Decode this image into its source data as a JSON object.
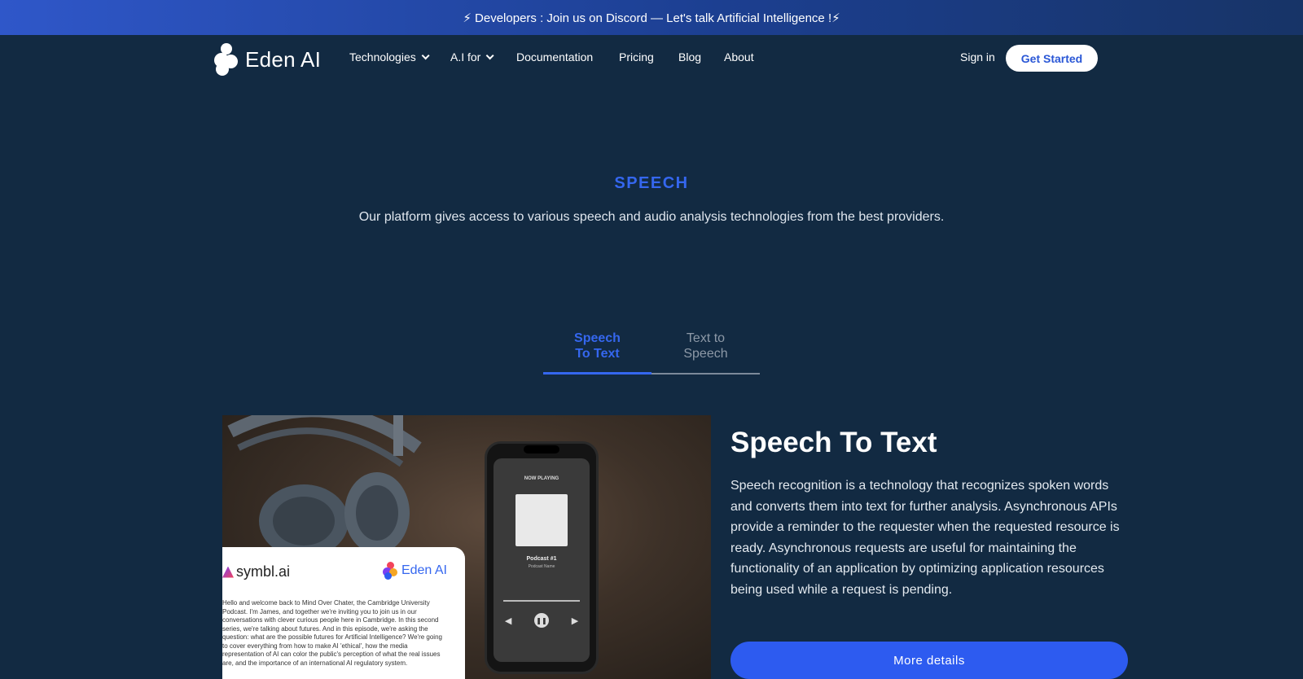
{
  "banner": {
    "text": "⚡ Developers : Join us on Discord — Let's talk Artificial Intelligence !⚡"
  },
  "nav": {
    "logo_text": "Eden AI",
    "items": [
      {
        "label": "Technologies",
        "dropdown": true
      },
      {
        "label": "A.I for",
        "dropdown": true
      },
      {
        "label": "Documentation",
        "dropdown": false
      },
      {
        "label": "Pricing",
        "dropdown": false
      },
      {
        "label": "Blog",
        "dropdown": false
      },
      {
        "label": "About",
        "dropdown": false
      }
    ],
    "signin_label": "Sign in",
    "get_started_label": "Get Started"
  },
  "hero": {
    "label": "SPEECH",
    "description": "Our platform gives access to various speech and audio analysis technologies from the best providers."
  },
  "tabs": [
    {
      "label": "Speech To Text",
      "active": true
    },
    {
      "label": "Text to Speech",
      "active": false
    }
  ],
  "illustration": {
    "phone": {
      "now_playing": "NOW PLAYING",
      "title": "Podcast #1",
      "subtitle": "Podcast Name"
    },
    "card": {
      "left_logo": "symbl.ai",
      "right_logo": "Eden AI",
      "transcript": "Hello and welcome back to Mind Over Chater, the Cambridge University Podcast. I'm James, and together we're inviting you to join us in our conversations with clever curious people here in Cambridge. In this second series, we're talking about futures. And in this episode, we're asking the question: what are the possible futures for Artificial Intelligence? We're going to cover everything from how to make AI 'ethical', how the media representation of AI can color the public's perception of what the real issues are, and the importance of an international AI regulatory system."
    }
  },
  "content": {
    "title": "Speech To Text",
    "body": "Speech recognition is a technology that recognizes spoken words and converts them into text for further analysis. Asynchronous APIs provide a reminder to the requester when the requested resource is ready. Asynchronous requests are useful for maintaining the functionality of an application by optimizing application resources being used while a request is pending.",
    "button_label": "More details"
  },
  "colors": {
    "background": "#122a42",
    "accent": "#3567ef",
    "button": "#2d5bf0"
  }
}
